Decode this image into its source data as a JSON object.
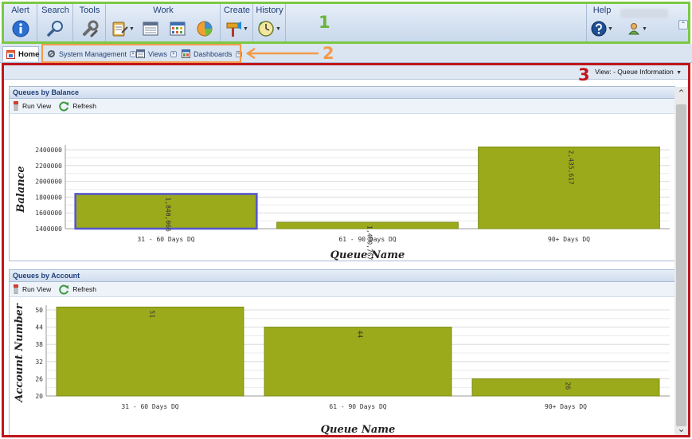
{
  "ribbon": {
    "groups": {
      "alert": "Alert",
      "search": "Search",
      "tools": "Tools",
      "work": "Work",
      "create": "Create",
      "history": "History",
      "help": "Help"
    },
    "icons": {
      "alert": "info-icon",
      "search": "magnifier-icon",
      "tools": "wrench-icon",
      "work": [
        "clipboard-icon",
        "list-icon",
        "calendar-icon",
        "pie-icon"
      ],
      "create": "hammer-icon",
      "history": "clock-icon",
      "help": "question-icon",
      "user": "user-icon"
    }
  },
  "tabs": [
    {
      "label": "Home",
      "icon": "home-icon"
    },
    {
      "label": "System Management",
      "icon": "gear-icon"
    },
    {
      "label": "Views",
      "icon": "grid-icon"
    },
    {
      "label": "Dashboards",
      "icon": "dashboard-icon"
    }
  ],
  "callouts": {
    "one": "1",
    "two": "2",
    "three": "3"
  },
  "content": {
    "view_label": "View: - Queue Information",
    "panels": [
      {
        "title": "Queues by Balance",
        "run_view": "Run View",
        "refresh": "Refresh"
      },
      {
        "title": "Queues by Account",
        "run_view": "Run View",
        "refresh": "Refresh"
      }
    ]
  },
  "colors": {
    "bar": "#9aaa1b",
    "bar_border": "#7c8c12",
    "highlight": "#5555cc",
    "ribbon_outline": "#7ac943",
    "tabs_outline": "#f49a4b",
    "content_outline": "#c0161b"
  },
  "chart_data": [
    {
      "type": "bar",
      "categories": [
        "31 - 60 Days DQ",
        "61 - 90 Days DQ",
        "90+ Days DQ"
      ],
      "values": [
        1840066,
        1480767,
        2435617
      ],
      "value_labels": [
        "1,840,066",
        "1,480,767",
        "2,435,617"
      ],
      "xlabel": "Queue Name",
      "ylabel": "Balance",
      "ylim": [
        1400000,
        2400000
      ],
      "yticks": [
        "1400000",
        "1600000",
        "1800000",
        "2000000",
        "2200000",
        "2400000"
      ],
      "grid": true
    },
    {
      "type": "bar",
      "categories": [
        "31 - 60 Days DQ",
        "61 - 90 Days DQ",
        "90+ Days DQ"
      ],
      "values": [
        51,
        44,
        26
      ],
      "value_labels": [
        "51",
        "44",
        "26"
      ],
      "xlabel": "Queue Name",
      "ylabel": "Account Number",
      "ylim": [
        20,
        50
      ],
      "yticks": [
        "20",
        "26",
        "32",
        "38",
        "44",
        "50"
      ],
      "grid": true
    }
  ]
}
